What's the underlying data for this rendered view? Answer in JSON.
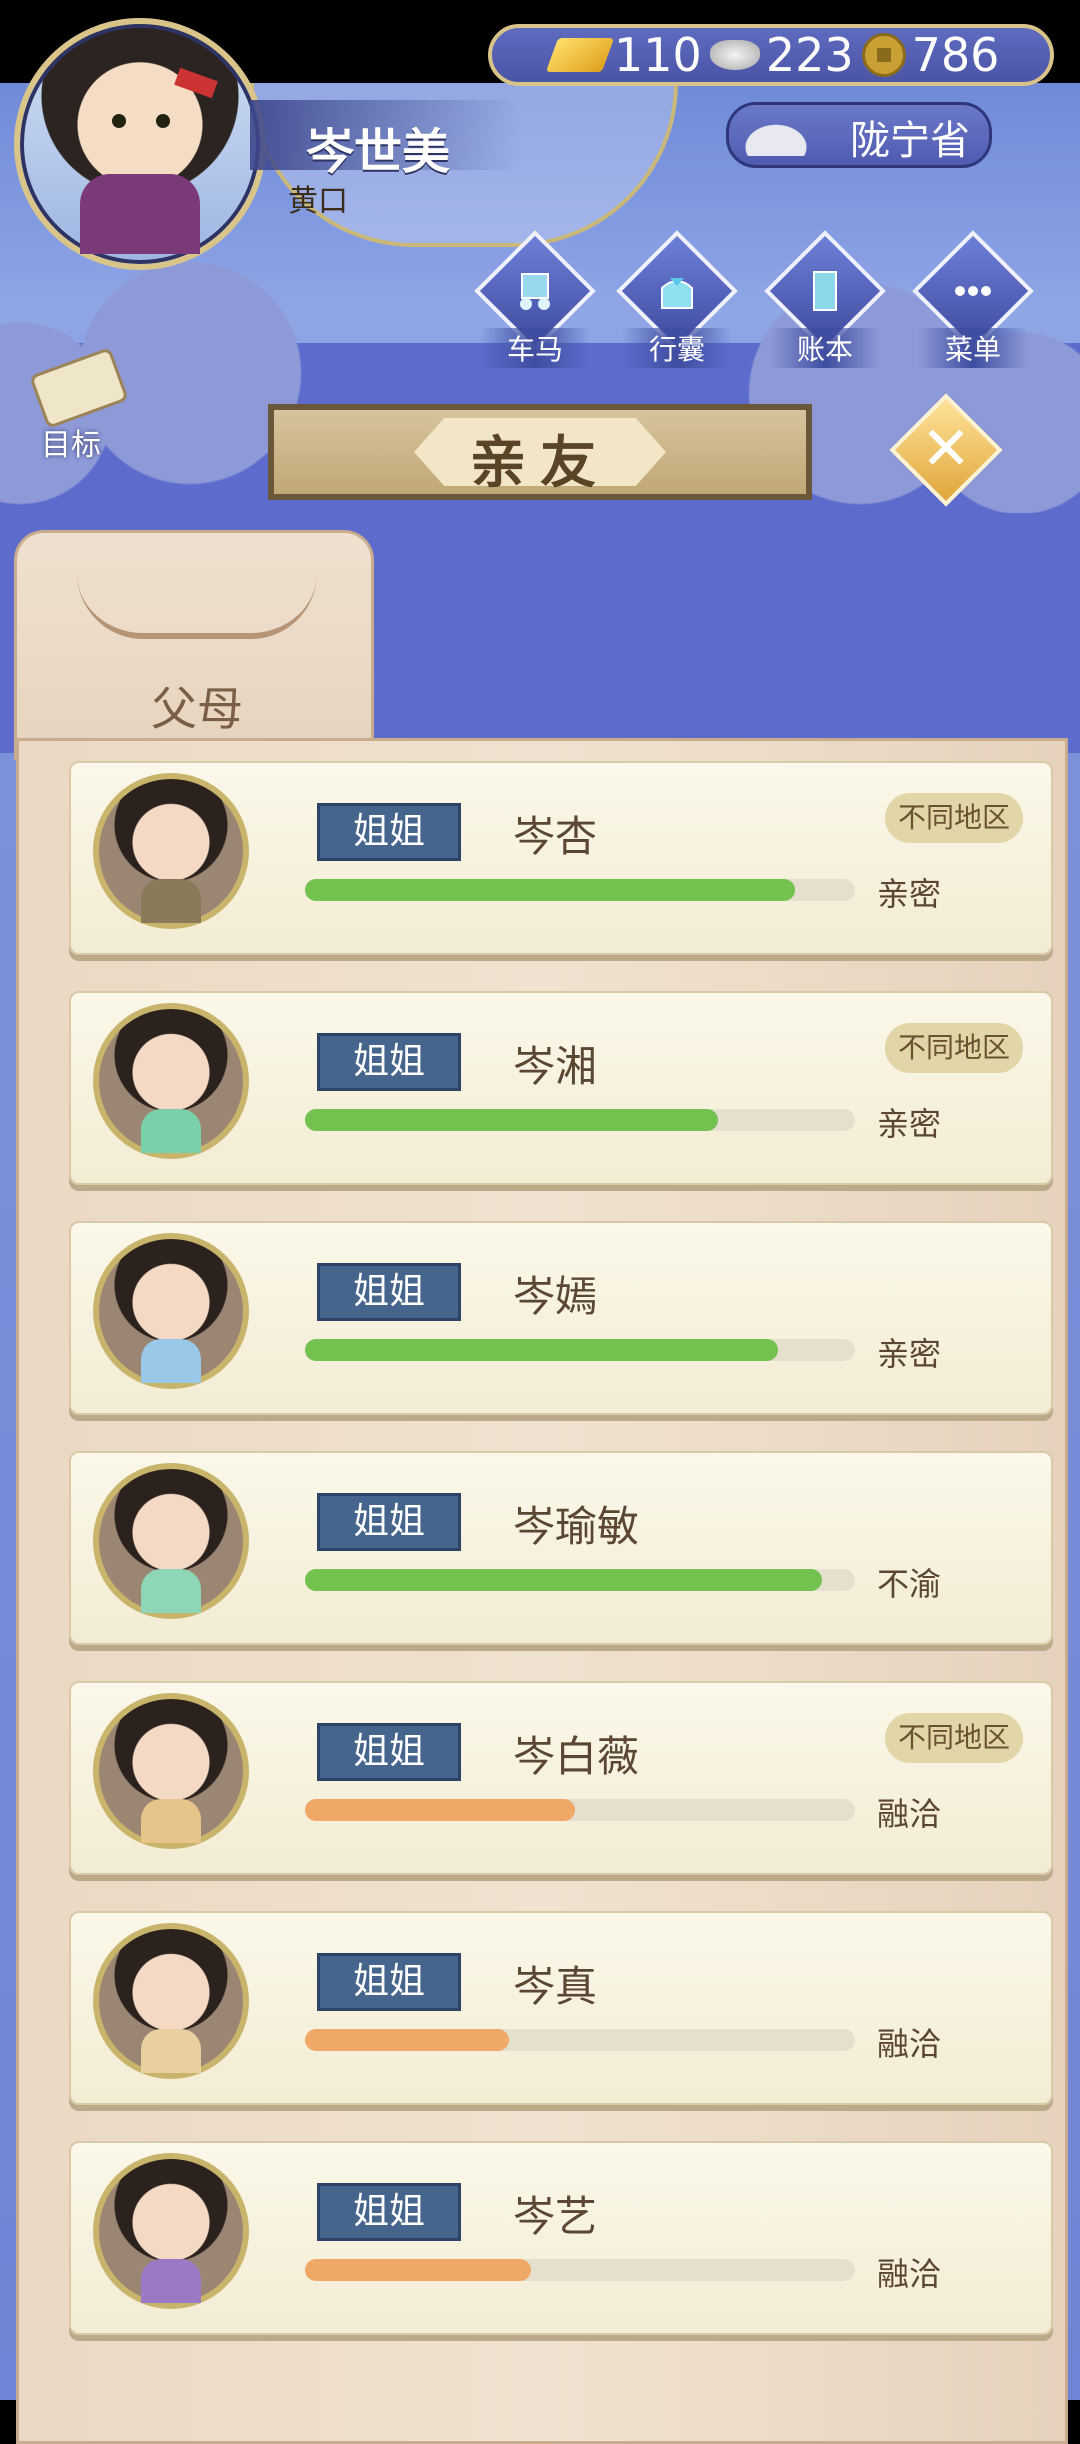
{
  "player": {
    "name": "岑世美",
    "title": "黄口"
  },
  "currency": {
    "gold": "110",
    "silver": "223",
    "coins": "786"
  },
  "location": "陇宁省",
  "nav": [
    {
      "label": "车马",
      "icon": "carriage-icon"
    },
    {
      "label": "行囊",
      "icon": "bag-icon"
    },
    {
      "label": "账本",
      "icon": "ledger-icon"
    },
    {
      "label": "菜单",
      "icon": "menu-icon"
    }
  ],
  "goal_label": "目标",
  "page_title": "亲友",
  "tab_label": "父母",
  "colors": {
    "bar_green": "#73c250",
    "bar_orange": "#f0a867",
    "tag_blue": "#46658c"
  },
  "members": [
    {
      "relation": "姐姐",
      "name": "岑杏",
      "region": "不同地区",
      "status": "亲密",
      "bond": 0.89,
      "bar": "green",
      "dress": "#8a7a5a"
    },
    {
      "relation": "姐姐",
      "name": "岑湘",
      "region": "不同地区",
      "status": "亲密",
      "bond": 0.75,
      "bar": "green",
      "dress": "#7ad0a8"
    },
    {
      "relation": "姐姐",
      "name": "岑嫣",
      "region": "",
      "status": "亲密",
      "bond": 0.86,
      "bar": "green",
      "dress": "#9ac8e8"
    },
    {
      "relation": "姐姐",
      "name": "岑瑜敏",
      "region": "",
      "status": "不渝",
      "bond": 0.94,
      "bar": "green",
      "dress": "#8ed6b6"
    },
    {
      "relation": "姐姐",
      "name": "岑白薇",
      "region": "不同地区",
      "status": "融洽",
      "bond": 0.49,
      "bar": "orange",
      "dress": "#e6c48a"
    },
    {
      "relation": "姐姐",
      "name": "岑真",
      "region": "",
      "status": "融洽",
      "bond": 0.37,
      "bar": "orange",
      "dress": "#e8d0a0"
    },
    {
      "relation": "姐姐",
      "name": "岑艺",
      "region": "",
      "status": "融洽",
      "bond": 0.41,
      "bar": "orange",
      "dress": "#9a7ac4"
    }
  ]
}
